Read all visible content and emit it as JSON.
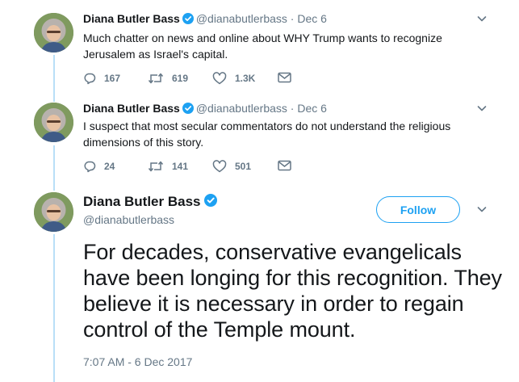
{
  "author": {
    "name": "Diana Butler Bass",
    "handle": "@dianabutlerbass"
  },
  "colors": {
    "accent": "#1da1f2",
    "muted": "#657786",
    "thread_line": "#b9dff7"
  },
  "tweets": [
    {
      "separator": "·",
      "date": "Dec 6",
      "text": "Much chatter on news and online about WHY Trump wants to recognize Jerusalem as Israel's capital.",
      "replies": "167",
      "retweets": "619",
      "likes": "1.3K"
    },
    {
      "separator": "·",
      "date": "Dec 6",
      "text": "I suspect that most secular commentators do not understand the religious dimensions of this story.",
      "replies": "24",
      "retweets": "141",
      "likes": "501"
    }
  ],
  "main_tweet": {
    "follow_label": "Follow",
    "text": "For decades, conservative evangelicals have been longing for this recognition. They believe it is necessary in order to regain control of the Temple mount.",
    "timestamp": "7:07 AM - 6 Dec 2017"
  },
  "icons": {
    "verified": "verified-badge-icon",
    "caret": "chevron-down-icon",
    "reply": "reply-icon",
    "retweet": "retweet-icon",
    "like": "heart-icon",
    "dm": "envelope-icon"
  }
}
